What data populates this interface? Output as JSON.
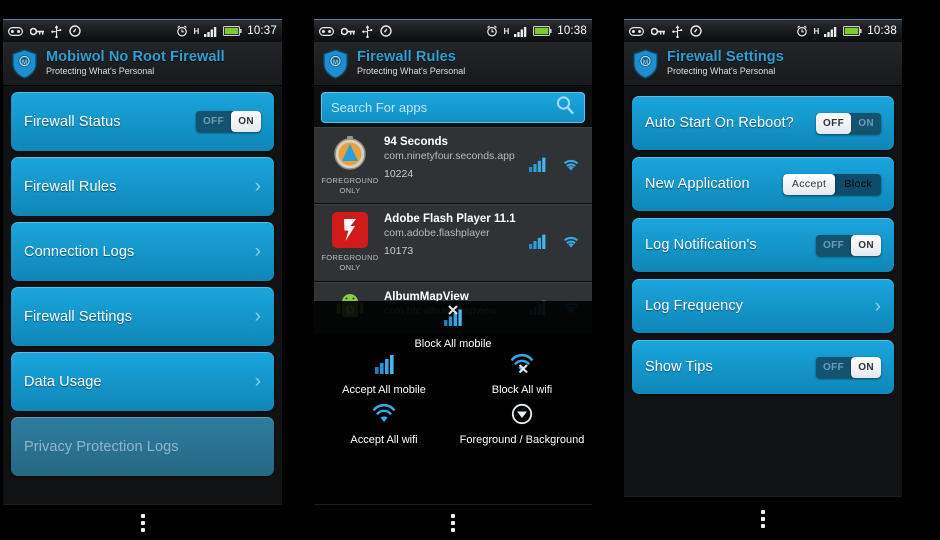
{
  "phones": [
    {
      "id": "phone-firewall-main",
      "statusbar": {
        "icons": [
          "voicemail-icon",
          "key-icon",
          "usb-icon",
          "debug-icon"
        ],
        "alarm": "alarm-icon",
        "network_type": "H",
        "signal": "signal-bars-icon",
        "battery": "battery-icon",
        "time": "10:37"
      },
      "header": {
        "title": "Mobiwol No Root Firewall",
        "subtitle": "Protecting What's Personal",
        "logo": "shield-logo"
      },
      "cards": [
        {
          "label": "Firewall Status",
          "control": "toggle",
          "options": [
            "OFF",
            "ON"
          ],
          "selected": "ON"
        },
        {
          "label": "Firewall Rules",
          "control": "chevron"
        },
        {
          "label": "Connection Logs",
          "control": "chevron"
        },
        {
          "label": "Firewall Settings",
          "control": "chevron"
        },
        {
          "label": "Data Usage",
          "control": "chevron"
        },
        {
          "label": "Privacy Protection Logs",
          "control": "none",
          "disabled": true
        }
      ]
    },
    {
      "id": "phone-firewall-rules",
      "statusbar": {
        "icons": [
          "voicemail-icon",
          "key-icon",
          "usb-icon",
          "debug-icon"
        ],
        "alarm": "alarm-icon",
        "network_type": "H",
        "signal": "signal-bars-icon",
        "battery": "battery-icon",
        "time": "10:38"
      },
      "header": {
        "title": "Firewall Rules",
        "subtitle": "Protecting What's Personal",
        "logo": "shield-logo"
      },
      "search": {
        "placeholder": "Search For apps",
        "icon": "search-icon"
      },
      "apps": [
        {
          "name": "94 Seconds",
          "package": "com.ninetyfour.seconds.app",
          "uid": "10224",
          "mode": "FOREGROUND ONLY",
          "icon": "stopwatch-app-icon",
          "mobile": "enabled",
          "wifi": "enabled"
        },
        {
          "name": "Adobe Flash Player 11.1",
          "package": "com.adobe.flashplayer",
          "uid": "10173",
          "mode": "FOREGROUND ONLY",
          "icon": "flash-app-icon",
          "mobile": "enabled",
          "wifi": "enabled"
        },
        {
          "name": "AlbumMapView",
          "package": "com.htc.album.mapview",
          "uid": "",
          "mode": "",
          "icon": "android-app-icon",
          "mobile": "enabled",
          "wifi": "enabled"
        }
      ],
      "overlay": {
        "items": [
          {
            "label": "Block All mobile",
            "icon": "signal-block-icon"
          },
          {
            "label": "Accept All mobile",
            "icon": "signal-accept-icon"
          },
          {
            "label": "Block All wifi",
            "icon": "wifi-block-icon"
          },
          {
            "label": "Accept All wifi",
            "icon": "wifi-accept-icon"
          },
          {
            "label": "Foreground / Background",
            "icon": "circle-arrow-down-icon"
          }
        ]
      }
    },
    {
      "id": "phone-firewall-settings",
      "statusbar": {
        "icons": [
          "voicemail-icon",
          "key-icon",
          "usb-icon",
          "debug-icon"
        ],
        "alarm": "alarm-icon",
        "network_type": "H",
        "signal": "signal-bars-icon",
        "battery": "battery-icon",
        "time": "10:38"
      },
      "header": {
        "title": "Firewall Settings",
        "subtitle": "Protecting What's Personal",
        "logo": "shield-logo"
      },
      "cards": [
        {
          "label": "Auto Start On Reboot?",
          "control": "toggle",
          "options": [
            "OFF",
            "ON"
          ],
          "selected": "OFF"
        },
        {
          "label": "New Application",
          "control": "toggle-wide",
          "options": [
            "Accept",
            "Block"
          ],
          "selected": "Accept"
        },
        {
          "label": "Log Notification's",
          "control": "toggle",
          "options": [
            "OFF",
            "ON"
          ],
          "selected": "ON"
        },
        {
          "label": "Log Frequency",
          "control": "chevron"
        },
        {
          "label": "Show Tips",
          "control": "toggle",
          "options": [
            "OFF",
            "ON"
          ],
          "selected": "ON"
        }
      ]
    }
  ],
  "colors": {
    "accent": "#1ba6de",
    "accent_dark": "#0f87b8",
    "title": "#2f9fd4",
    "disabled_card": "#2d7d9e",
    "battery": "#7ec832",
    "background": "#000000"
  },
  "bottom_menu_icon": "overflow-kebab-icon"
}
